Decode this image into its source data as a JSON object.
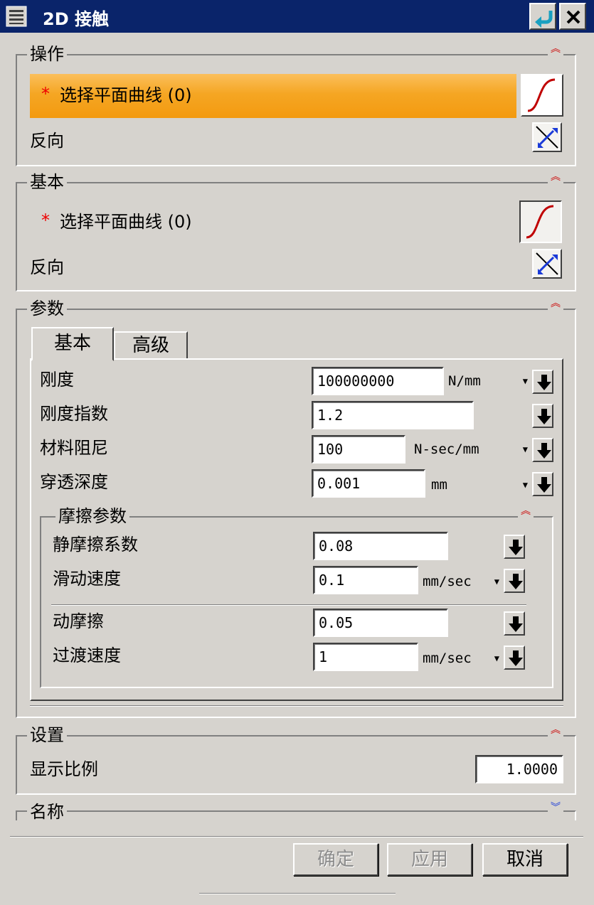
{
  "window": {
    "title": "2D 接触"
  },
  "sections": {
    "operation": {
      "legend": "操作",
      "select_label": "选择平面曲线 (0)",
      "reverse_label": "反向"
    },
    "basic": {
      "legend": "基本",
      "select_label": "选择平面曲线 (0)",
      "reverse_label": "反向"
    },
    "params": {
      "legend": "参数",
      "tabs": [
        "基本",
        "高级"
      ],
      "rows": [
        {
          "label": "刚度",
          "value": "100000000",
          "unit": "N/mm"
        },
        {
          "label": "刚度指数",
          "value": "1.2",
          "unit": ""
        },
        {
          "label": "材料阻尼",
          "value": "100",
          "unit": "N-sec/mm"
        },
        {
          "label": "穿透深度",
          "value": "0.001",
          "unit": "mm"
        }
      ],
      "friction": {
        "legend": "摩擦参数",
        "rows": [
          {
            "label": "静摩擦系数",
            "value": "0.08",
            "unit": ""
          },
          {
            "label": "滑动速度",
            "value": "0.1",
            "unit": "mm/sec"
          },
          {
            "label": "动摩擦",
            "value": "0.05",
            "unit": ""
          },
          {
            "label": "过渡速度",
            "value": "1",
            "unit": "mm/sec"
          }
        ]
      }
    },
    "settings": {
      "legend": "设置",
      "display_scale_label": "显示比例",
      "display_scale_value": "1.0000"
    },
    "name": {
      "legend": "名称"
    }
  },
  "buttons": {
    "ok": "确定",
    "apply": "应用",
    "cancel": "取消"
  },
  "required_marker": "*",
  "icons": {
    "menu": "list-icon",
    "reset": "reset-arrow-icon",
    "close": "close-icon",
    "curve": "spline-curve-icon",
    "reverse": "reverse-direction-icon",
    "collapse": "chevron-double-up-icon",
    "expand": "chevron-double-down-icon",
    "dropdown": "arrow-down-icon"
  },
  "colors": {
    "title_bar": "#0a246a",
    "selection_highlight": "#f5a623",
    "required": "#e00000",
    "dialog_bg": "#d6d3ce"
  }
}
